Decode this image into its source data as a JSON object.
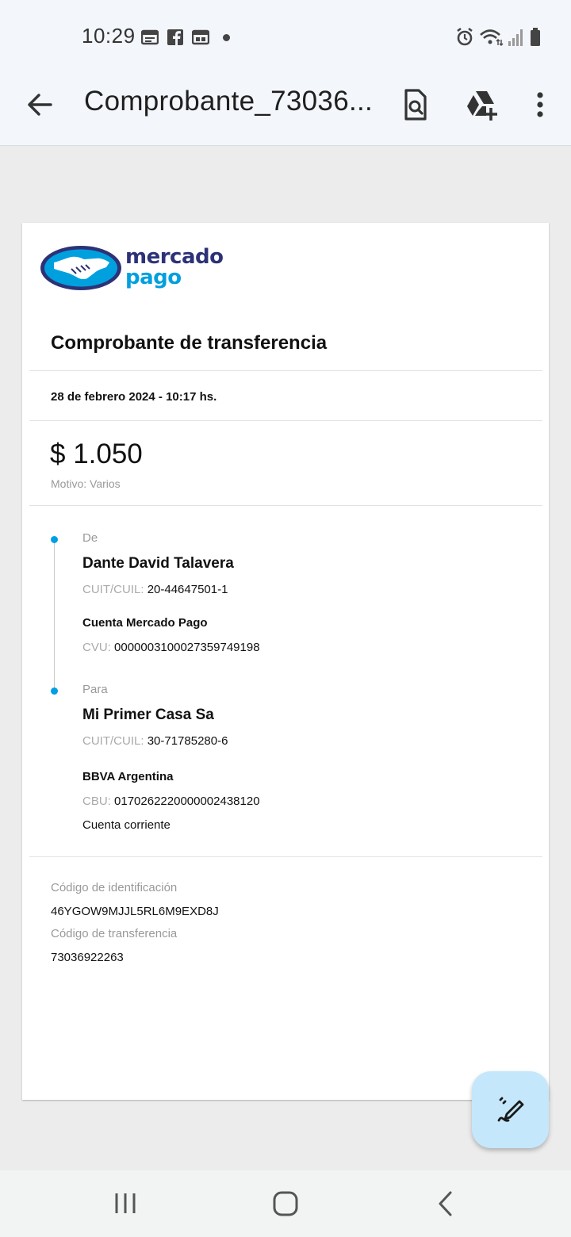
{
  "status_bar": {
    "time": "10:29",
    "icons": [
      "calendar-icon",
      "facebook-icon",
      "calendar-icon",
      "notification-dot",
      "alarm-icon",
      "wifi-icon",
      "signal-icon",
      "battery-icon"
    ]
  },
  "app_bar": {
    "title": "Comprobante_73036...",
    "actions": [
      "search-document-icon",
      "drive-add-icon",
      "more-vert-icon"
    ]
  },
  "document": {
    "logo": {
      "line1": "mercado",
      "line2": "pago"
    },
    "title": "Comprobante de transferencia",
    "date": "28 de febrero 2024 - 10:17 hs.",
    "amount": "$ 1.050",
    "motivo": "Motivo: Varios",
    "from": {
      "label": "De",
      "name": "Dante David Talavera",
      "cuit_label": "CUIT/CUIL:",
      "cuit_value": "20-44647501-1",
      "account": "Cuenta Mercado Pago",
      "cvu_label": "CVU:",
      "cvu_value": "0000003100027359749198"
    },
    "to": {
      "label": "Para",
      "name": "Mi Primer Casa Sa",
      "cuit_label": "CUIT/CUIL:",
      "cuit_value": "30-71785280-6",
      "bank": "BBVA Argentina",
      "cbu_label": "CBU:",
      "cbu_value": "0170262220000002438120",
      "account_type": "Cuenta corriente"
    },
    "identification_label": "Código de identificación",
    "identification_value": "46YGOW9MJJL5RL6M9EXD8J",
    "transfer_label": "Código de transferencia",
    "transfer_value": "73036922263"
  },
  "colors": {
    "accent": "#009ee3",
    "brand_dark": "#2d3277",
    "fab_bg": "#c4e7fb"
  }
}
